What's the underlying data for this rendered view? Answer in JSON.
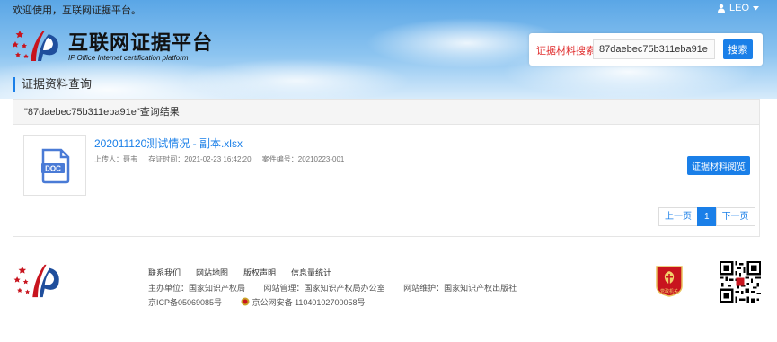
{
  "topbar": {
    "welcome": "欢迎使用，互联网证据平台。",
    "user": "LEO"
  },
  "logo": {
    "title": "互联网证据平台",
    "subtitle": "IP Office Internet certification platform"
  },
  "search": {
    "label": "证据材料搜索:",
    "value": "87daebec75b311eba91e",
    "button": "搜索"
  },
  "section_title": "证据资料查询",
  "results": {
    "heading": "\"87daebec75b311eba91e\"查询结果",
    "items": [
      {
        "icon_text": "DOC",
        "file_name": "202011120测试情况 - 副本.xlsx",
        "uploader": "上传人：聂韦",
        "stored_time": "存证时间：2021-02-23 16:42:20",
        "case_no": "案件编号：20210223-001",
        "view_button": "证据材料阅览"
      }
    ],
    "pager": {
      "prev": "上一页",
      "current": "1",
      "next": "下一页"
    }
  },
  "footer": {
    "links": [
      "联系我们",
      "网站地图",
      "版权声明",
      "信息量统计"
    ],
    "sponsor": "主办单位：国家知识产权局",
    "admin": "网站管理：国家知识产权局办公室",
    "maintain": "网站维护：国家知识产权出版社",
    "icp": "京ICP备05069085号",
    "police": "京公网安备 11040102700058号",
    "badge_text": "党政机关"
  },
  "colors": {
    "accent": "#1a7fe8",
    "label_red": "#e02d2d"
  }
}
